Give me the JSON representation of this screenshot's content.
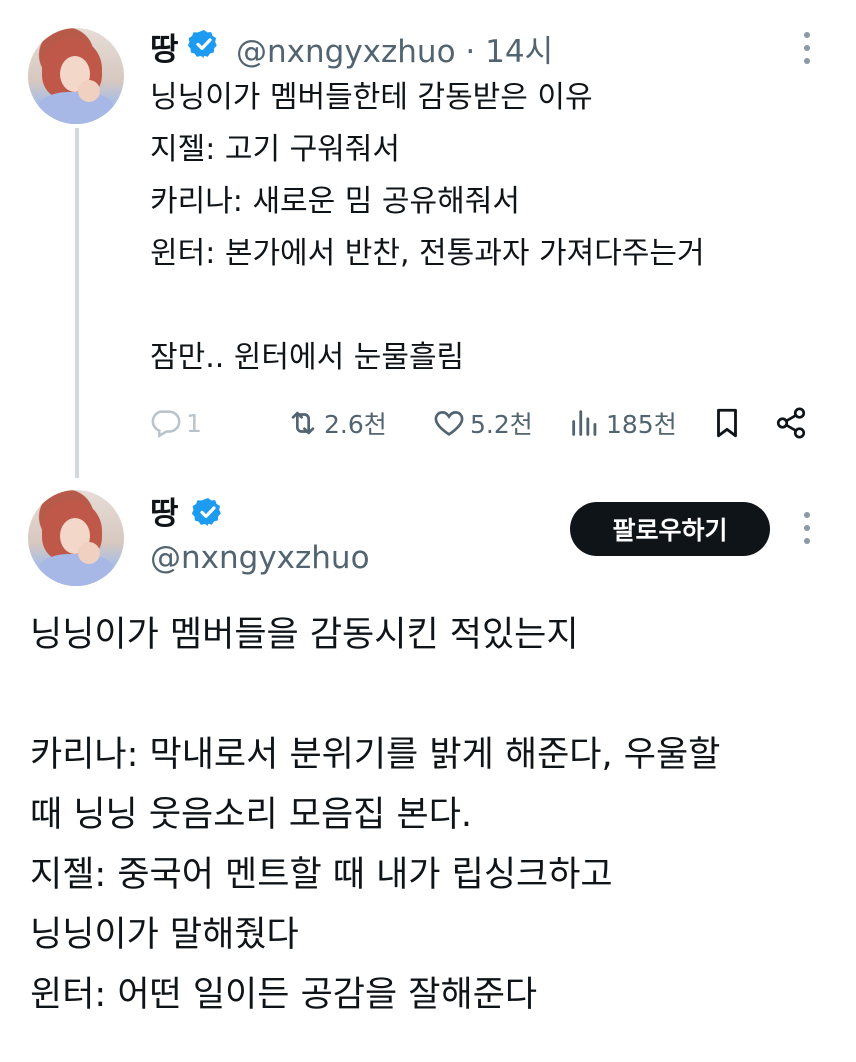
{
  "reply_tweet": {
    "author_name": "땅",
    "handle": "@nxngyxzhuo",
    "separator": "·",
    "time": "14시",
    "text": "닝닝이가 멤버들한테 감동받은 이유\n지젤: 고기 구워줘서\n카리나: 새로운 밈 공유해줘서\n윈터: 본가에서 반찬, 전통과자 가져다주는거\n\n잠만.. 윈터에서 눈물흘림",
    "actions": {
      "reply_count": "1",
      "retweet_count": "2.6천",
      "like_count": "5.2천",
      "view_count": "185천"
    }
  },
  "main_tweet": {
    "author_name": "땅",
    "handle": "@nxngyxzhuo",
    "follow_label": "팔로우하기",
    "text": "닝닝이가 멤버들을 감동시킨 적있는지\n\n카리나: 막내로서 분위기를 밝게 해준다, 우울할\n때 닝닝 웃음소리 모음집 본다.\n지젤: 중국어 멘트할 때 내가 립싱크하고\n닝닝이가 말해줬다\n윈터: 어떤 일이든 공감을 잘해준다"
  },
  "icons": [
    "verified-badge-icon",
    "more-options-icon",
    "reply-icon",
    "retweet-icon",
    "like-icon",
    "views-icon",
    "bookmark-icon",
    "share-icon"
  ],
  "colors": {
    "verified": "#1d9bf0",
    "secondary_text": "#536471",
    "follow_button": "#0f1419"
  }
}
